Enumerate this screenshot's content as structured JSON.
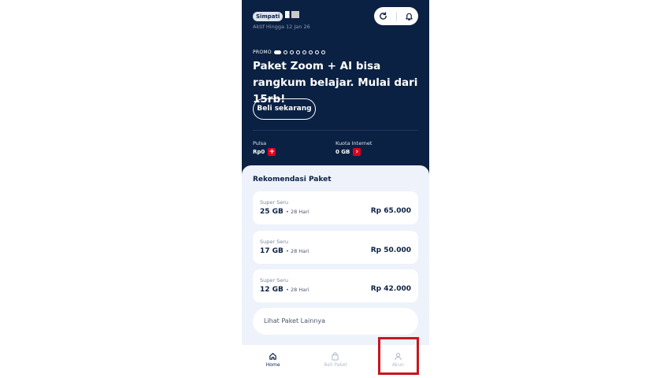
{
  "header": {
    "brand": "Simpati",
    "active_until": "Aktif Hingga 12 Jan 26"
  },
  "icons": {
    "refresh": "refresh-icon",
    "notification": "bell-icon"
  },
  "promo": {
    "label": "PROMO",
    "total_slides": 8,
    "active_slide": 1,
    "headline": "Paket Zoom + AI bisa rangkum belajar. Mulai dari 15rb!",
    "cta": "Beli sekarang"
  },
  "balances": {
    "pulsa_label": "Pulsa",
    "pulsa_value": "Rp0",
    "kuota_label": "Kuota Internet",
    "kuota_value": "0 GB"
  },
  "recommendations": {
    "title": "Rekomendasi Paket",
    "items": [
      {
        "name": "Super Seru",
        "quota": "25 GB",
        "duration": "• 28 Hari",
        "price": "Rp 65.000"
      },
      {
        "name": "Super Seru",
        "quota": "17 GB",
        "duration": "• 28 Hari",
        "price": "Rp 50.000"
      },
      {
        "name": "Super Seru",
        "quota": "12 GB",
        "duration": "• 28 Hari",
        "price": "Rp 42.000"
      }
    ],
    "more_label": "Lihat Paket Lainnya"
  },
  "nav": {
    "items": [
      {
        "label": "Home",
        "icon": "home-icon",
        "active": true
      },
      {
        "label": "Beli Paket",
        "icon": "shopping-bag-icon",
        "active": false
      },
      {
        "label": "Akun",
        "icon": "user-icon",
        "active": false
      }
    ]
  },
  "colors": {
    "navy": "#0b2143",
    "accent_red": "#e1001c",
    "highlight": "#c8161d",
    "panel_bg": "#edf2fb"
  }
}
